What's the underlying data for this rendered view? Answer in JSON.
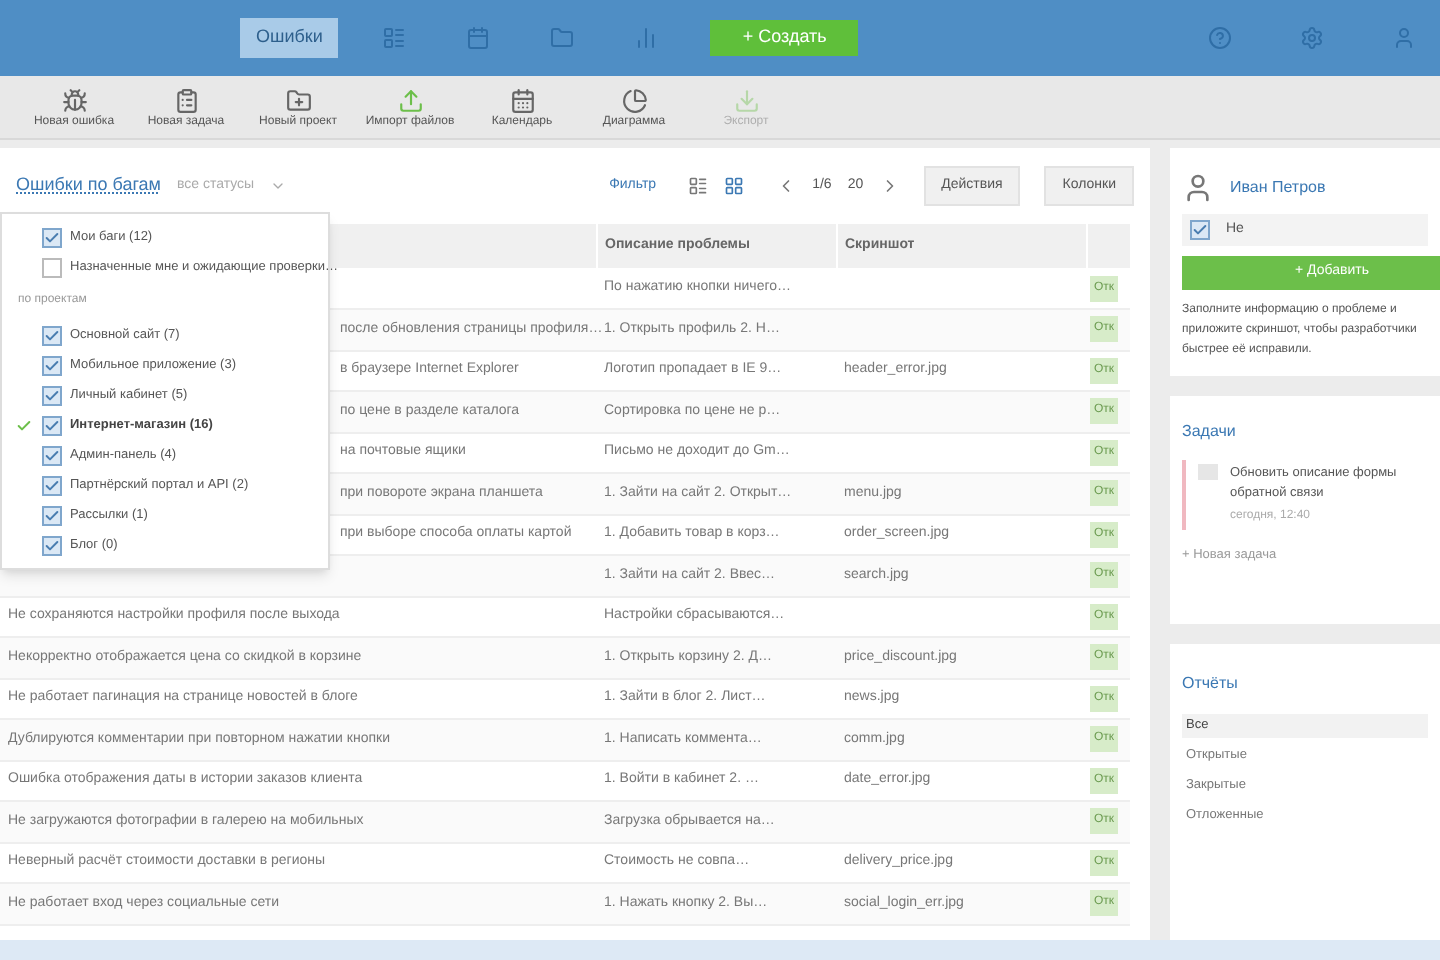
{
  "topbar": {
    "tabs": [
      {
        "label": "Ошибки",
        "selected": true
      },
      {
        "selected": false
      },
      {
        "selected": false
      },
      {
        "selected": false
      },
      {
        "selected": false
      }
    ],
    "create_button": "+ Создать"
  },
  "toolbar": [
    {
      "label": "Новая ошибка",
      "disabled": false
    },
    {
      "label": "Новая задача",
      "disabled": false
    },
    {
      "label": "Новый проект",
      "disabled": false
    },
    {
      "label": "Импорт файлов",
      "disabled": false
    },
    {
      "label": "Календарь",
      "disabled": false
    },
    {
      "label": "Диаграмма",
      "disabled": false
    },
    {
      "label": "Экспорт",
      "disabled": true
    }
  ],
  "filter_bar": {
    "title": "Ошибки по багам",
    "scope": "все статусы",
    "filter_link": "Фильтр",
    "page": "1/6",
    "per_page": "20",
    "buttons": [
      "Действия",
      "Колонки"
    ]
  },
  "dropdown": {
    "top_items": [
      {
        "label": "Мои баги (12)",
        "checked": true
      },
      {
        "label": "Назначенные мне и ожидающие проверки…",
        "checked": false
      }
    ],
    "group": "по проектам",
    "items": [
      {
        "label": "Основной сайт (7)",
        "checked": true,
        "selected": false
      },
      {
        "label": "Мобильное приложение (3)",
        "checked": true,
        "selected": false
      },
      {
        "label": "Личный кабинет (5)",
        "checked": true,
        "selected": false
      },
      {
        "label": "Интернет-магазин (16)",
        "checked": true,
        "selected": true
      },
      {
        "label": "Админ-панель (4)",
        "checked": true,
        "selected": false
      },
      {
        "label": "Партнёрский портал и API (2)",
        "checked": true,
        "selected": false
      },
      {
        "label": "Рассылки (1)",
        "checked": true,
        "selected": false
      },
      {
        "label": "Блог (0)",
        "checked": true,
        "selected": false
      }
    ]
  },
  "table": {
    "columns": [
      null,
      "Описание проблемы",
      "Скриншот",
      null
    ],
    "rows": [
      {
        "kind": "covered",
        "cells": [
          null,
          "По нажатию кнопки ничего…",
          null
        ],
        "status": "Отк"
      },
      {
        "kind": "covered",
        "cells": [
          "после обновления страницы профиля…",
          "1. Открыть профиль 2. Н…",
          null
        ],
        "status": "Отк"
      },
      {
        "kind": "covered",
        "cells": [
          "в браузере Internet Explorer",
          "Логотип пропадает в IE 9…",
          "header_error.jpg"
        ],
        "status": "Отк"
      },
      {
        "kind": "covered",
        "cells": [
          "по цене в разделе каталога",
          "Сортировка по цене не р…",
          null
        ],
        "status": "Отк"
      },
      {
        "kind": "covered",
        "cells": [
          "на почтовые ящики",
          "Письмо не доходит до Gm…",
          null
        ],
        "status": "Отк"
      },
      {
        "kind": "covered",
        "cells": [
          "при повороте экрана планшета",
          "1. Зайти на сайт 2. Открыт…",
          "menu.jpg"
        ],
        "status": "Отк"
      },
      {
        "kind": "covered",
        "cells": [
          "при выборе способа оплаты картой",
          "1. Добавить товар в корз…",
          "order_screen.jpg"
        ],
        "status": "Отк"
      },
      {
        "kind": "covered",
        "cells": [
          null,
          "1. Зайти на сайт 2. Ввес…",
          "search.jpg"
        ],
        "status": "Отк"
      },
      {
        "cells": [
          "Не сохраняются настройки профиля после выхода",
          "Настройки сбрасываются…",
          null
        ],
        "status": "Отк"
      },
      {
        "cells": [
          "Некорректно отображается цена со скидкой в корзине",
          "1. Открыть корзину 2. Д…",
          "price_discount.jpg"
        ],
        "status": "Отк"
      },
      {
        "cells": [
          "Не работает пагинация на странице новостей в блоге",
          "1. Зайти в блог 2. Лист…",
          "news.jpg"
        ],
        "status": "Отк"
      },
      {
        "cells": [
          "Дублируются комментарии при повторном нажатии кнопки",
          "1. Написать коммента…",
          "comm.jpg"
        ],
        "status": "Отк"
      },
      {
        "cells": [
          "Ошибка отображения даты в истории заказов клиента",
          "1. Войти в кабинет 2. …",
          "date_error.jpg"
        ],
        "status": "Отк"
      },
      {
        "cells": [
          "Не загружаются фотографии в галерею на мобильных",
          "Загрузка обрывается на…",
          null
        ],
        "status": "Отк"
      },
      {
        "cells": [
          "Неверный расчёт стоимости доставки в регионы",
          "Стоимость не совпа…",
          "delivery_price.jpg"
        ],
        "status": "Отк"
      },
      {
        "cells": [
          "Не работает вход через социальные сети",
          "1. Нажать кнопку 2. Вы…",
          "social_login_err.jpg"
        ],
        "status": "Отк"
      }
    ]
  },
  "profile_card": {
    "name": "Иван Петров",
    "option": "Не",
    "checked": true,
    "button": "+ Добавить",
    "text": "Заполните информацию о проблеме и приложите скриншот, чтобы разработчики быстрее её исправили."
  },
  "tasks_card": {
    "title": "Задачи",
    "tasks": [
      {
        "title": "Обновить описание формы обратной связи",
        "meta": "сегодня, 12:40"
      }
    ],
    "link": "+ Новая задача"
  },
  "reports_card": {
    "title": "Отчёты",
    "items": [
      {
        "label": "Все",
        "selected": true
      },
      {
        "label": "Открытые",
        "selected": false
      },
      {
        "label": "Закрытые",
        "selected": false
      },
      {
        "label": "Отложенные",
        "selected": false
      }
    ]
  }
}
